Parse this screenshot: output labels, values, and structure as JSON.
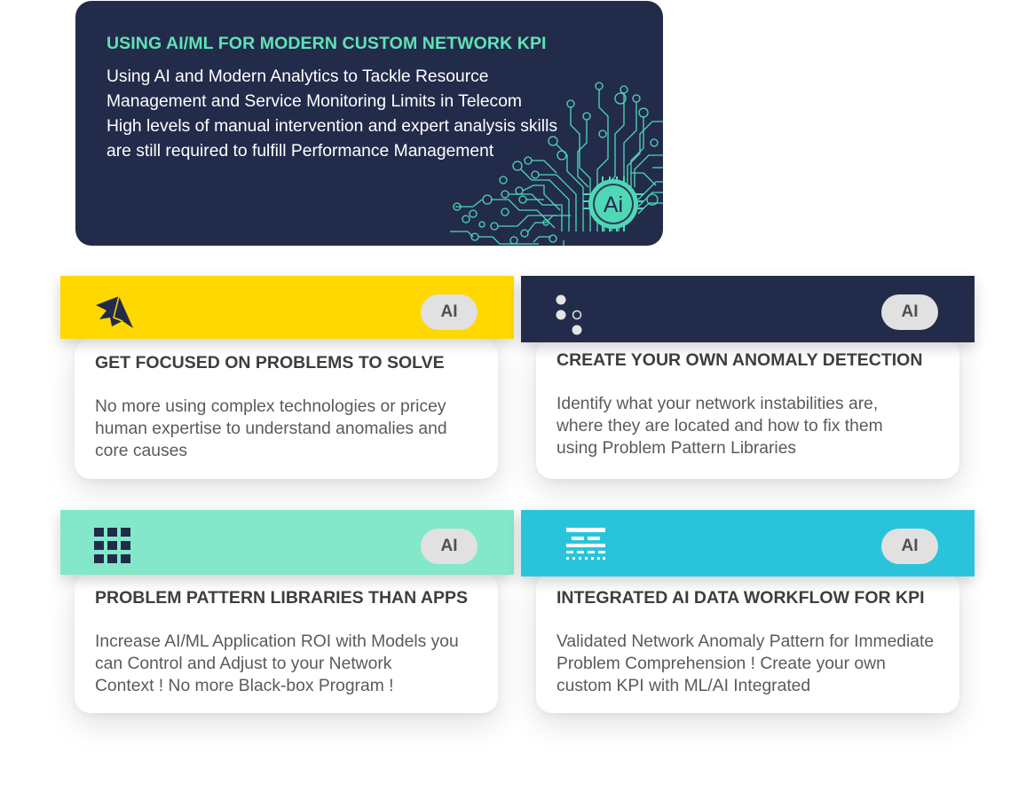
{
  "hero": {
    "title": "USING AI/ML FOR MODERN CUSTOM NETWORK KPI",
    "lines": [
      "Using AI and Modern Analytics to Tackle Resource",
      "Management and Service Monitoring Limits in Telecom",
      "High levels of manual intervention and expert analysis skills",
      "are still required to fulfill Performance Management"
    ],
    "chip_label": "Ai",
    "art_icon": "ai-circuit-illustration",
    "colors": {
      "background": "#232b4b",
      "title": "#5fe3b6",
      "circuit": "#4fd8b6"
    }
  },
  "features": [
    {
      "icon": "paper-plane-icon",
      "badge": "AI",
      "band_color": "#ffd800",
      "title": "GET FOCUSED ON PROBLEMS TO SOLVE",
      "description": [
        "No more using complex technologies or pricey",
        "human expertise to understand anomalies and",
        "core causes"
      ]
    },
    {
      "icon": "dots-cluster-icon",
      "badge": "AI",
      "band_color": "#232b4b",
      "title": "CREATE YOUR OWN ANOMALY DETECTION",
      "description": [
        "Identify what your network instabilities are,",
        "where they are located and how to fix them",
        "using Problem Pattern Libraries"
      ]
    },
    {
      "icon": "grid-icon",
      "badge": "AI",
      "band_color": "#82e8c9",
      "title": "PROBLEM PATTERN LIBRARIES THAN APPS",
      "description": [
        "Increase AI/ML Application ROI with Models you",
        "can Control and Adjust to your Network",
        "Context ! No more Black-box Program !"
      ]
    },
    {
      "icon": "data-table-icon",
      "badge": "AI",
      "band_color": "#29c4dc",
      "title": "INTEGRATED AI DATA WORKFLOW FOR KPI",
      "description": [
        "Validated Network Anomaly Pattern for Immediate",
        "Problem Comprehension ! Create your own",
        "custom KPI with ML/AI Integrated"
      ]
    }
  ]
}
